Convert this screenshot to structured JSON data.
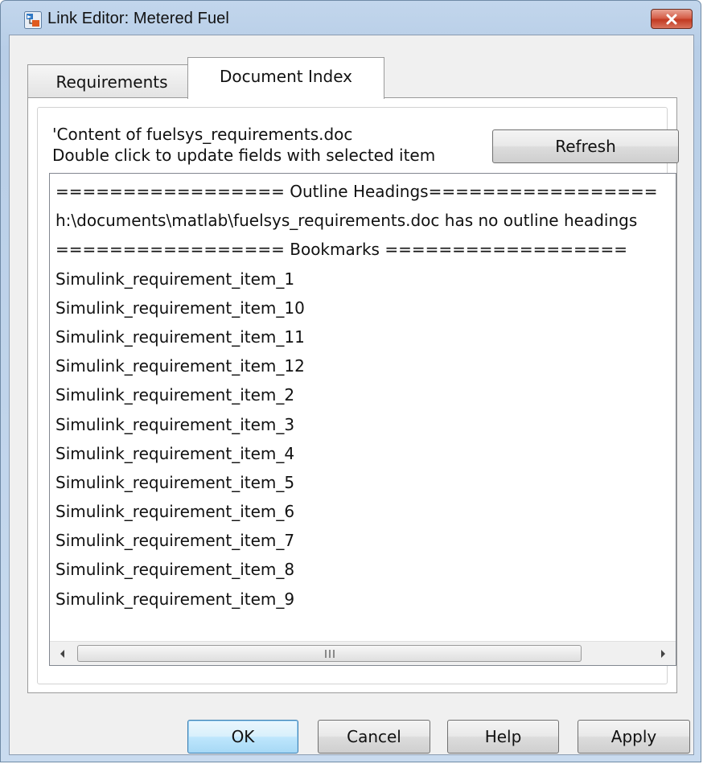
{
  "window": {
    "title": "Link Editor: Metered Fuel",
    "close_icon": "close-icon"
  },
  "tabs": [
    {
      "label": "Requirements",
      "active": false
    },
    {
      "label": "Document Index",
      "active": true
    }
  ],
  "document_index": {
    "content_line": "'Content of fuelsys_requirements.doc",
    "hint_line": "Double click to update fields with selected item",
    "refresh_label": "Refresh",
    "items": [
      "================= Outline Headings=================",
      "h:\\documents\\matlab\\fuelsys_requirements.doc has no outline headings",
      "================= Bookmarks ==================",
      "Simulink_requirement_item_1",
      "Simulink_requirement_item_10",
      "Simulink_requirement_item_11",
      "Simulink_requirement_item_12",
      "Simulink_requirement_item_2",
      "Simulink_requirement_item_3",
      "Simulink_requirement_item_4",
      "Simulink_requirement_item_5",
      "Simulink_requirement_item_6",
      "Simulink_requirement_item_7",
      "Simulink_requirement_item_8",
      "Simulink_requirement_item_9"
    ],
    "scrollbar_grip": "III"
  },
  "buttons": {
    "ok": "OK",
    "cancel": "Cancel",
    "help": "Help",
    "apply": "Apply"
  },
  "colors": {
    "title_bar": "#b8cee7",
    "close_button": "#c23a22",
    "default_button_border": "#3c7fb1"
  }
}
